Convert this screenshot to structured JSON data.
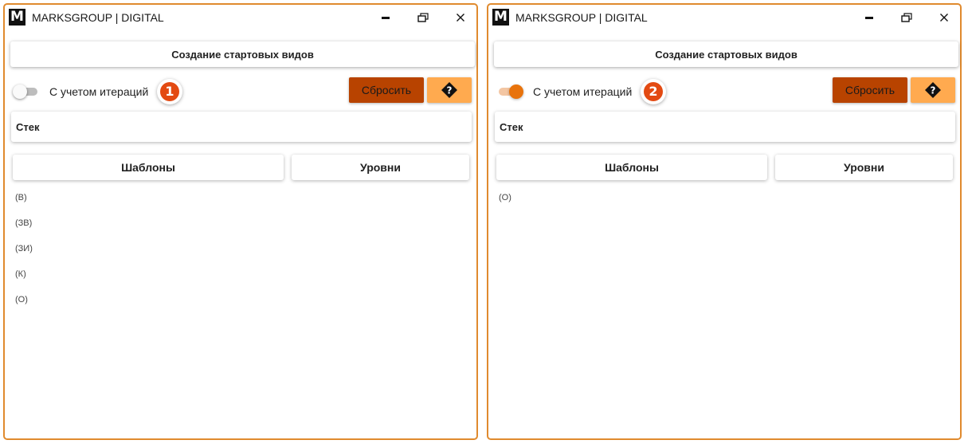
{
  "colors": {
    "window_border": "#e08a2e",
    "reset_button": "#b84300",
    "help_button": "#ffaa4f",
    "toggle_on": "#e8730c",
    "badge": "#e34a12"
  },
  "windows": [
    {
      "title": "MARKSGROUP | DIGITAL",
      "logo": "M",
      "icons": {
        "minimize": "minimize-icon",
        "maximize": "restore-icon",
        "close": "close-icon"
      },
      "create_button": "Создание стартовых видов",
      "toggle": {
        "label": "С учетом итераций",
        "on": false
      },
      "badge": "1",
      "reset_button": "Сбросить",
      "help_icon": "help-diamond-icon",
      "stack_label": "Стек",
      "templates_button": "Шаблоны",
      "levels_button": "Уровни",
      "items": [
        "(В)",
        "(ЗВ)",
        "(ЗИ)",
        "(К)",
        "(О)"
      ]
    },
    {
      "title": "MARKSGROUP | DIGITAL",
      "logo": "M",
      "icons": {
        "minimize": "minimize-icon",
        "maximize": "restore-icon",
        "close": "close-icon"
      },
      "create_button": "Создание стартовых видов",
      "toggle": {
        "label": "С учетом итераций",
        "on": true
      },
      "badge": "2",
      "reset_button": "Сбросить",
      "help_icon": "help-diamond-icon",
      "stack_label": "Стек",
      "templates_button": "Шаблоны",
      "levels_button": "Уровни",
      "items": [
        "(О)"
      ]
    }
  ]
}
